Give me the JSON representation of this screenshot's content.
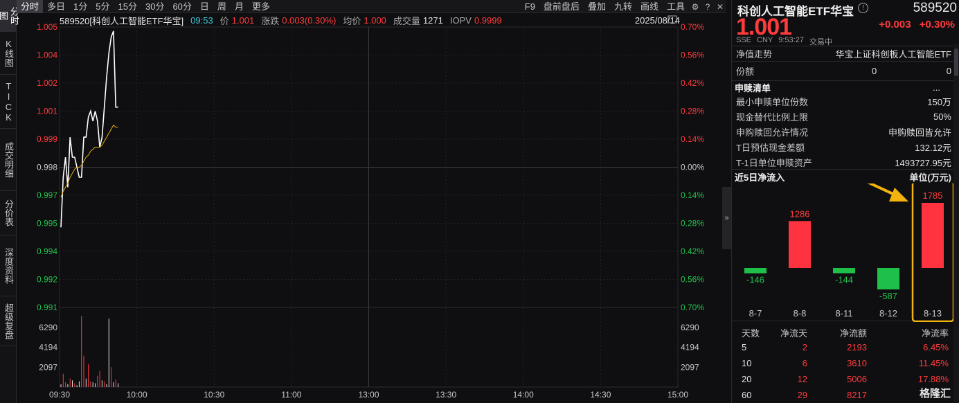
{
  "left_tabs": [
    "分时图",
    "K线图",
    "TICK",
    "成交明细",
    "分价表",
    "深度资料",
    "超级复盘"
  ],
  "toolbar": {
    "items": [
      "分时",
      "多日",
      "1分",
      "5分",
      "15分",
      "30分",
      "60分",
      "日",
      "周",
      "月",
      "更多"
    ],
    "right_items": [
      "F9",
      "盘前盘后",
      "叠加",
      "九转",
      "画线",
      "工具"
    ],
    "active": "分时"
  },
  "info_bar": {
    "name": "589520[科创人工智能ETF华宝]",
    "time": "09:53",
    "price_label": "价",
    "price": "1.001",
    "change_label": "涨跌",
    "change": "0.003(0.30%)",
    "avg_label": "均价",
    "avg": "1.000",
    "vol_label": "成交量",
    "vol": "1271",
    "iopv_label": "IOPV",
    "iopv": "0.9999",
    "date": "2025/08/14"
  },
  "chart_data": {
    "type": "line",
    "title": "",
    "x_ticks": [
      "09:30",
      "10:00",
      "10:30",
      "11:00",
      "13:00",
      "13:30",
      "14:00",
      "14:30",
      "15:00"
    ],
    "price_ticks": [
      "1.005",
      "1.004",
      "1.002",
      "1.001",
      "0.999",
      "0.998",
      "0.997",
      "0.995",
      "0.994",
      "0.992",
      "0.991"
    ],
    "pct_ticks": [
      "0.70%",
      "0.56%",
      "0.42%",
      "0.28%",
      "0.14%",
      "0.00%",
      "0.14%",
      "0.28%",
      "0.42%",
      "0.56%",
      "0.70%"
    ],
    "prev_close": 0.998,
    "ylim": [
      0.991,
      1.005
    ],
    "volume_ticks": [
      "6290",
      "4194",
      "2097"
    ],
    "volume_max": 8387,
    "price_series": [
      0.995,
      0.9975,
      0.9985,
      0.997,
      0.9995,
      0.9985,
      0.9985,
      0.998,
      0.9975,
      0.9975,
      0.9995,
      0.9995,
      1.0005,
      1.0008,
      1.0003,
      1.0008,
      1.0003,
      0.999,
      0.9995,
      1.001,
      1.0025,
      1.0037,
      1.0045,
      1.0048,
      1.001,
      1.001
    ],
    "avg_series": [
      0.9965,
      0.9968,
      0.997,
      0.9972,
      0.9975,
      0.9977,
      0.9979,
      0.998,
      0.998,
      0.9981,
      0.9983,
      0.9985,
      0.9986,
      0.9988,
      0.9989,
      0.999,
      0.999,
      0.999,
      0.9991,
      0.9993,
      0.9995,
      0.9997,
      0.9999,
      1.0001,
      1.0,
      1.0
    ],
    "volume_series": [
      300,
      1400,
      500,
      300,
      900,
      700,
      400,
      200,
      600,
      7500,
      3300,
      900,
      2400,
      600,
      500,
      400,
      1200,
      1700,
      700,
      600,
      300,
      7200,
      2100,
      500,
      800,
      400
    ],
    "volume_colors": [
      "w",
      "r",
      "r",
      "w",
      "r",
      "w",
      "r",
      "w",
      "w",
      "r",
      "r",
      "w",
      "r",
      "r",
      "w",
      "w",
      "r",
      "r",
      "w",
      "r",
      "w",
      "w",
      "r",
      "w",
      "r",
      "w"
    ]
  },
  "right_panel": {
    "title": "科创人工智能ETF华宝",
    "code": "589520",
    "price": "1.001",
    "change": "+0.003",
    "change_pct": "+0.30%",
    "meta": [
      "SSE",
      "CNY",
      "9:53:27",
      "交易中"
    ],
    "nav_label": "净值走势",
    "nav_value": "华宝上证科创板人工智能ETF",
    "shares_label": "份额",
    "shares_a": "0",
    "shares_b": "0",
    "redeem_title": "申赎清单",
    "more": "...",
    "rows": [
      {
        "label": "最小申赎单位份数",
        "value": "150万"
      },
      {
        "label": "现金替代比例上限",
        "value": "50%"
      },
      {
        "label": "申购赎回允许情况",
        "value": "申购赎回皆允许"
      },
      {
        "label": "T日预估现金差额",
        "value": "132.12元"
      },
      {
        "label": "T-1日单位申赎资产",
        "value": "1493727.95元"
      }
    ],
    "flow_title": "近5日净流入",
    "flow_unit": "单位(万元)",
    "flow_data": {
      "type": "bar",
      "categories": [
        "8-7",
        "8-8",
        "8-11",
        "8-12",
        "8-13"
      ],
      "values": [
        -146,
        1286,
        -144,
        -587,
        1785
      ]
    },
    "table_header": [
      "天数",
      "净流天",
      "净流额",
      "净流率"
    ],
    "table_rows": [
      [
        "5",
        "2",
        "2193",
        "6.45%"
      ],
      [
        "10",
        "6",
        "3610",
        "11.45%"
      ],
      [
        "20",
        "12",
        "5006",
        "17.88%"
      ],
      [
        "60",
        "29",
        "8217",
        ""
      ]
    ],
    "watermark": "格隆汇"
  }
}
